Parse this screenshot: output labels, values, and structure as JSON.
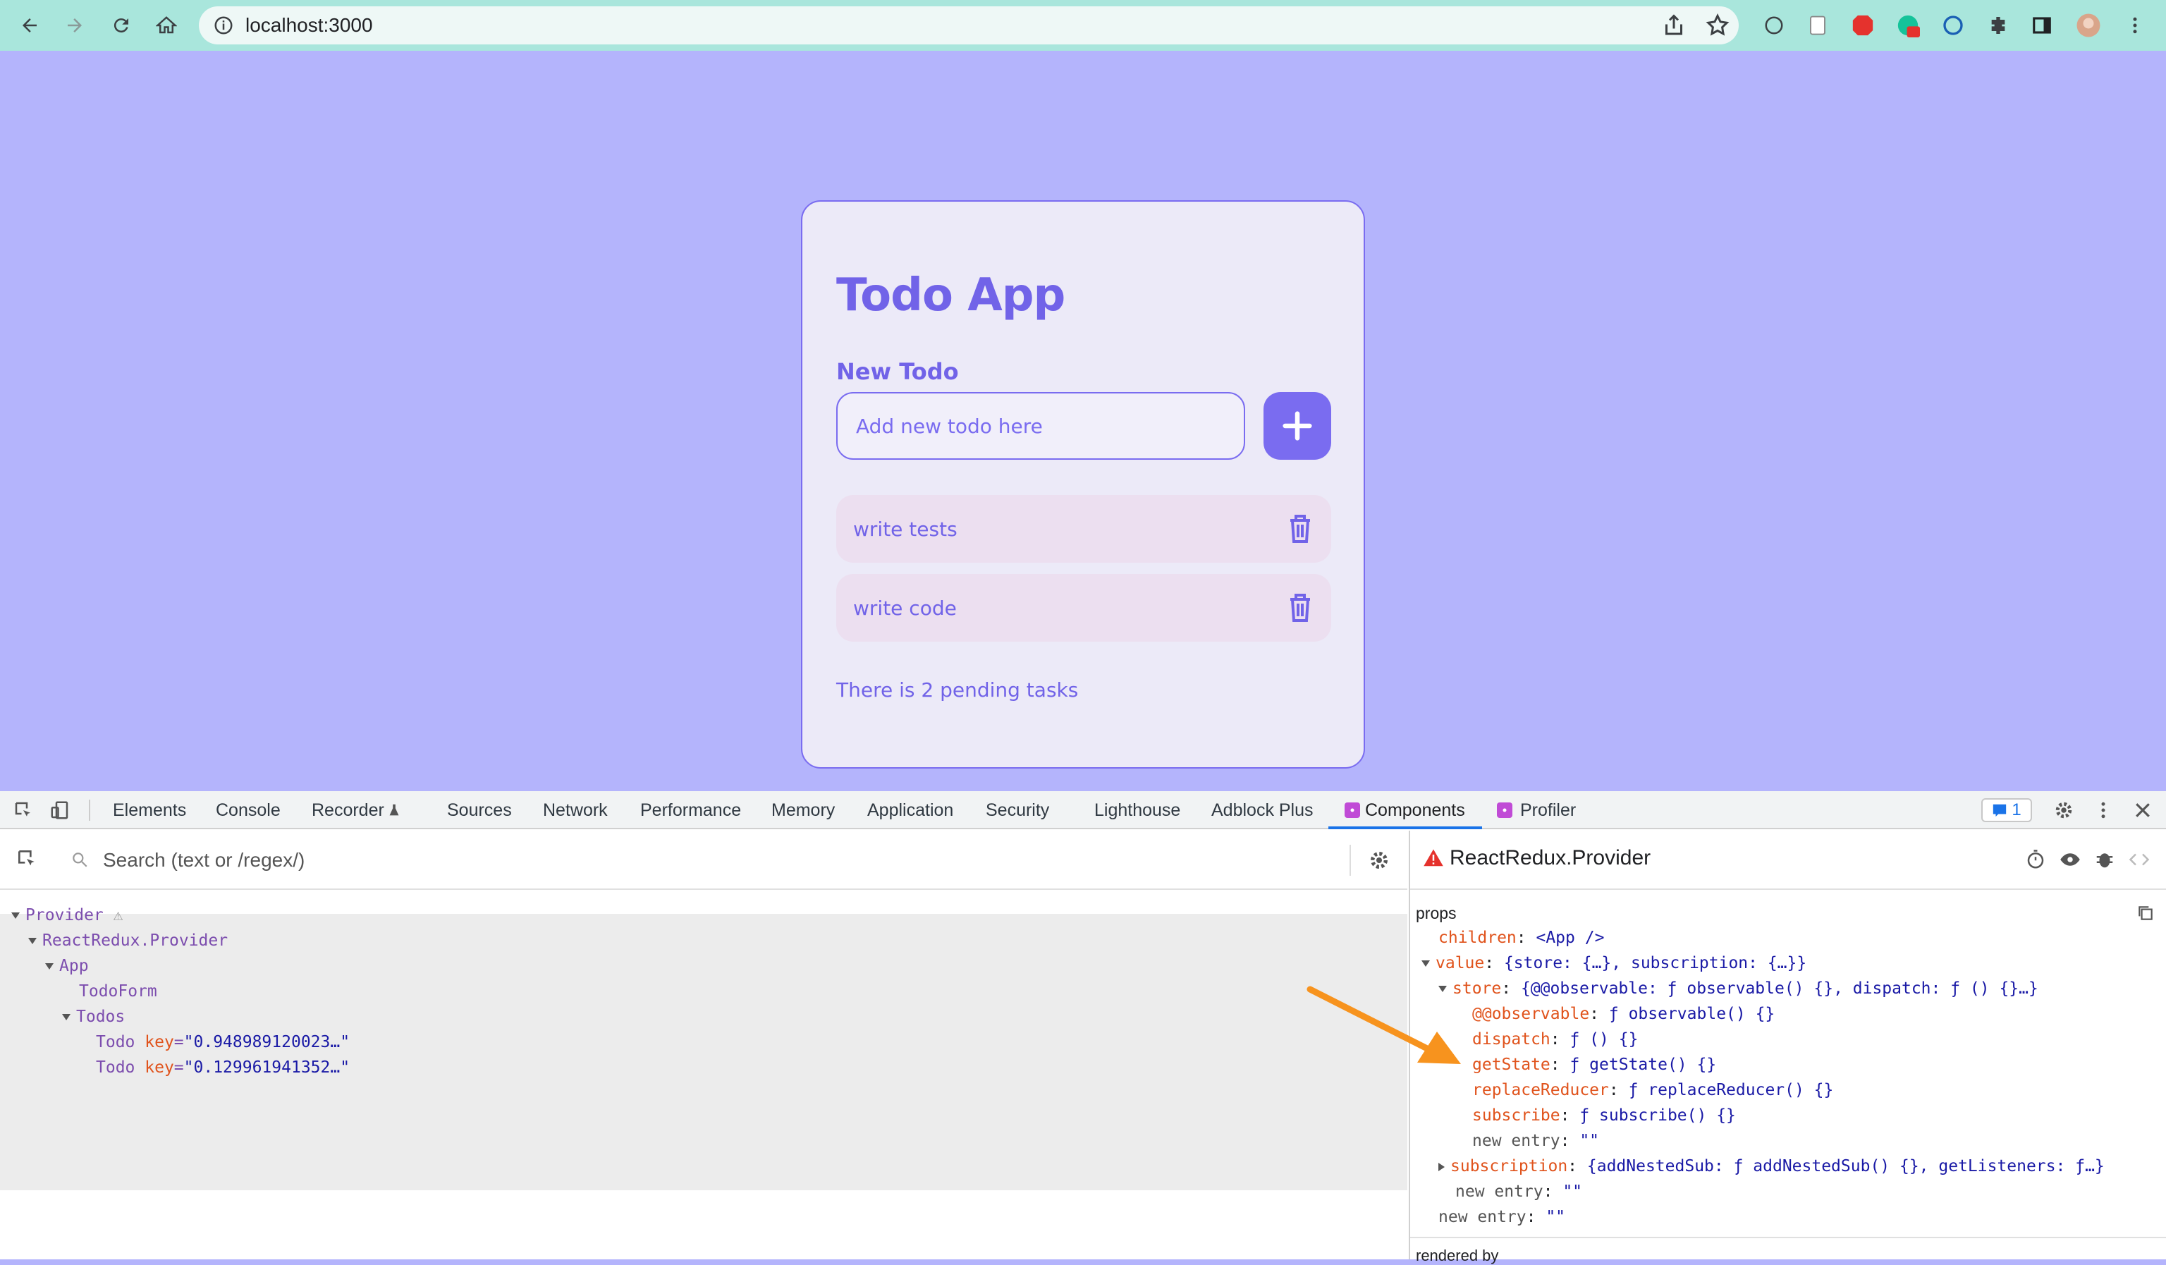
{
  "browser": {
    "url": "localhost:3000"
  },
  "app": {
    "title": "Todo App",
    "section_label": "New Todo",
    "input_placeholder": "Add new todo here",
    "todos": [
      {
        "text": "write tests"
      },
      {
        "text": "write code"
      }
    ],
    "pending_text": "There is 2 pending tasks",
    "colors": {
      "accent": "#7a6cf0",
      "background": "#b4b4fc",
      "card": "#eceaf8",
      "item": "#ecdff0"
    }
  },
  "devtools": {
    "tabs": [
      "Elements",
      "Console",
      "Recorder",
      "Sources",
      "Network",
      "Performance",
      "Memory",
      "Application",
      "Security",
      "Lighthouse",
      "Adblock Plus",
      "Components",
      "Profiler"
    ],
    "active_tab": "Components",
    "issues_count": "1",
    "search_placeholder": "Search (text or /regex/)",
    "tree": [
      {
        "name": "Provider"
      },
      {
        "name": "ReactRedux.Provider"
      },
      {
        "name": "App"
      },
      {
        "name": "TodoForm"
      },
      {
        "name": "Todos"
      },
      {
        "name": "Todo",
        "attr": "key",
        "value": "\"0.948989120023…\""
      },
      {
        "name": "Todo",
        "attr": "key",
        "value": "\"0.129961941352…\""
      }
    ],
    "selected_component": "ReactRedux.Provider",
    "props_label": "props",
    "props": [
      {
        "key": "children",
        "value": "<App />"
      },
      {
        "key": "value",
        "value": "{store: {…}, subscription: {…}}"
      },
      {
        "key": "store",
        "value": "{@@observable: ƒ observable() {}, dispatch: ƒ () {}…}"
      },
      {
        "key": "@@observable",
        "value": "ƒ observable() {}"
      },
      {
        "key": "dispatch",
        "value": "ƒ () {}"
      },
      {
        "key": "getState",
        "value": "ƒ getState() {}"
      },
      {
        "key": "replaceReducer",
        "value": "ƒ replaceReducer() {}"
      },
      {
        "key": "subscribe",
        "value": "ƒ subscribe() {}"
      },
      {
        "key": "new entry",
        "value": "\"\""
      },
      {
        "key": "subscription",
        "value": "{addNestedSub: ƒ addNestedSub() {}, getListeners: ƒ…}"
      },
      {
        "key": "new entry",
        "value": "\"\""
      },
      {
        "key": "new entry",
        "value": "\"\""
      }
    ],
    "rendered_by": "rendered by"
  }
}
